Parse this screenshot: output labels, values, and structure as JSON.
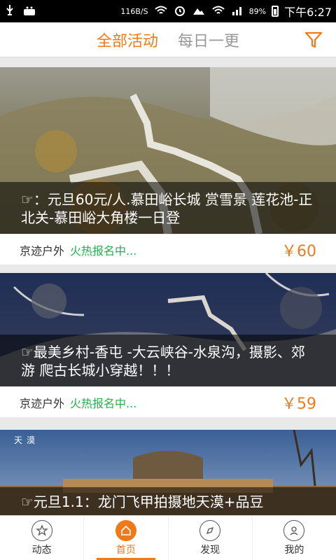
{
  "status_bar": {
    "net_speed": "116B/S",
    "battery_percent": "89%",
    "time": "下午6:27"
  },
  "header": {
    "tabs": [
      {
        "label": "全部活动",
        "active": true
      },
      {
        "label": "每日一更",
        "active": false
      }
    ],
    "filter_icon": "filter-icon"
  },
  "feed": {
    "cards": [
      {
        "caption": "☞：元旦60元/人.慕田峪长城 赏雪景 莲花池-正北关-慕田峪大角楼一日登",
        "organizer": "京迹户外",
        "status": "火热报名中...",
        "price": "￥60"
      },
      {
        "caption": "☞最美乡村-香屯 -大云峡谷-水泉沟，摄影、郊游 爬古长城小穿越！！！",
        "organizer": "京迹户外",
        "status": "火热报名中...",
        "price": "￥59"
      },
      {
        "caption": "☞元旦1.1：龙门飞甲拍摄地天漠+品豆",
        "image_text": "天漠"
      }
    ]
  },
  "bottom_nav": {
    "items": [
      {
        "label": "动态",
        "icon": "star-icon"
      },
      {
        "label": "首页",
        "icon": "home-icon",
        "active": true
      },
      {
        "label": "发现",
        "icon": "compass-icon"
      },
      {
        "label": "我的",
        "icon": "user-icon"
      }
    ]
  },
  "colors": {
    "accent": "#f07a1a",
    "green": "#22b14c"
  }
}
